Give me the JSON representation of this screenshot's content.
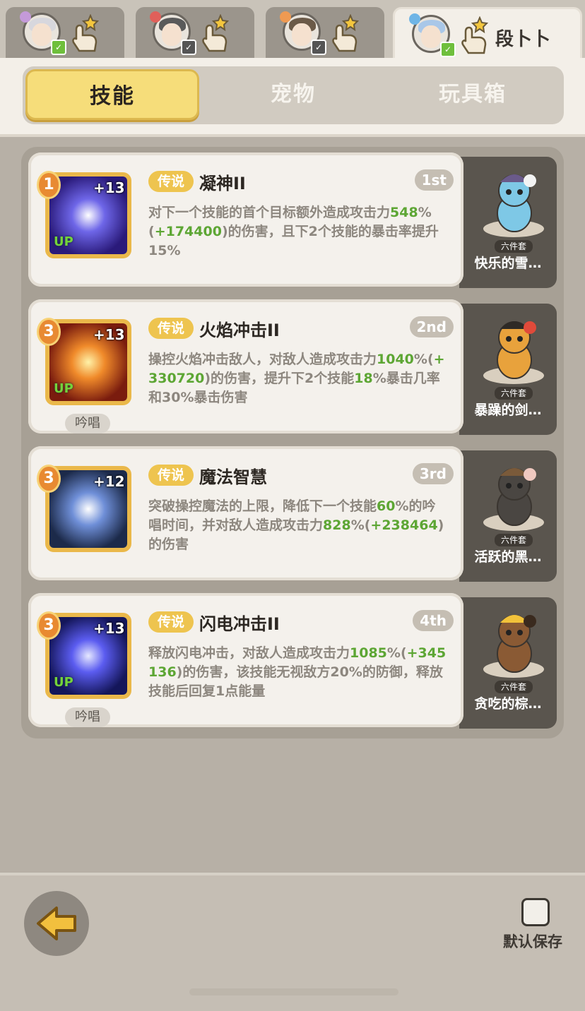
{
  "character_tabs": [
    {
      "name": "",
      "active": false,
      "badge": "online",
      "element_color": "#c49ad9",
      "hair_color": "#d7d7dd"
    },
    {
      "name": "",
      "active": false,
      "badge": "offline",
      "element_color": "#e0605a",
      "hair_color": "#5a5a5a"
    },
    {
      "name": "",
      "active": false,
      "badge": "offline",
      "element_color": "#ef9a52",
      "hair_color": "#6b5a48"
    },
    {
      "name": "段卜卜",
      "active": true,
      "badge": "online",
      "element_color": "#6fb5e6",
      "hair_color": "#a9c7e8"
    }
  ],
  "segment_tabs": [
    "技能",
    "宠物",
    "玩具箱"
  ],
  "active_segment": "技能",
  "skills": [
    {
      "level": "1",
      "plus": "+13",
      "up": "UP",
      "rarity": "传说",
      "name": "凝神II",
      "rank": "1st",
      "chant": "",
      "desc": [
        [
          "对下一个技能的首个目标额外造成攻击力",
          false
        ],
        [
          "548",
          true
        ],
        [
          "%(",
          false
        ],
        [
          "+174400",
          true
        ],
        [
          ")的伤害，且下2个技能的暴击率提升15%",
          false
        ]
      ],
      "icon_colors": [
        "#2a1a7a",
        "#6e66e8",
        "#ffffff"
      ],
      "pet": {
        "name": "快乐的雪…",
        "set": "六件套",
        "colors": [
          "#7ec8e6",
          "#6a5a8a",
          "#f3f3f3"
        ]
      }
    },
    {
      "level": "3",
      "plus": "+13",
      "up": "UP",
      "rarity": "传说",
      "name": "火焰冲击II",
      "rank": "2nd",
      "chant": "吟唱",
      "desc": [
        [
          "操控火焰冲击敌人，对敌人造成攻击力",
          false
        ],
        [
          "1040",
          true
        ],
        [
          "%(",
          false
        ],
        [
          "+330720",
          true
        ],
        [
          ")的伤害，提升下2个技能",
          false
        ],
        [
          "18",
          true
        ],
        [
          "%暴击几率和30%暴击伤害",
          false
        ]
      ],
      "icon_colors": [
        "#7a1c0e",
        "#f08a2a",
        "#fff2a8"
      ],
      "pet": {
        "name": "暴躁的剑…",
        "set": "六件套",
        "colors": [
          "#e8a23c",
          "#2e2a26",
          "#e04a3a"
        ]
      }
    },
    {
      "level": "3",
      "plus": "+12",
      "up": "",
      "rarity": "传说",
      "name": "魔法智慧",
      "rank": "3rd",
      "chant": "",
      "desc": [
        [
          "突破操控魔法的上限，降低下一个技能",
          false
        ],
        [
          "60",
          true
        ],
        [
          "%的吟唱时间，并对敌人造成攻击力",
          false
        ],
        [
          "828",
          true
        ],
        [
          "%(",
          false
        ],
        [
          "+238464",
          true
        ],
        [
          ")的伤害",
          false
        ]
      ],
      "icon_colors": [
        "#1c2a4a",
        "#6f8fd8",
        "#ffffff"
      ],
      "pet": {
        "name": "活跃的黑…",
        "set": "六件套",
        "colors": [
          "#4a4642",
          "#7a5a3a",
          "#f0c9c0"
        ]
      }
    },
    {
      "level": "3",
      "plus": "+13",
      "up": "UP",
      "rarity": "传说",
      "name": "闪电冲击II",
      "rank": "4th",
      "chant": "吟唱",
      "desc": [
        [
          "释放闪电冲击，对敌人造成攻击力",
          false
        ],
        [
          "1085",
          true
        ],
        [
          "%(",
          false
        ],
        [
          "+345136",
          true
        ],
        [
          ")的伤害，该技能无视敌方20%的防御，释放技能后回复1点能量",
          false
        ]
      ],
      "icon_colors": [
        "#14165a",
        "#5b5cf0",
        "#e6e8ff"
      ],
      "pet": {
        "name": "贪吃的棕…",
        "set": "六件套",
        "colors": [
          "#8a5a34",
          "#f2c23a",
          "#3a2a1e"
        ]
      }
    }
  ],
  "bottom": {
    "default_save_label": "默认保存",
    "default_save_checked": false
  },
  "theme": {
    "accent_yellow": "#f6dd7a",
    "green": "#5da634",
    "rarity": "#eec44f"
  }
}
